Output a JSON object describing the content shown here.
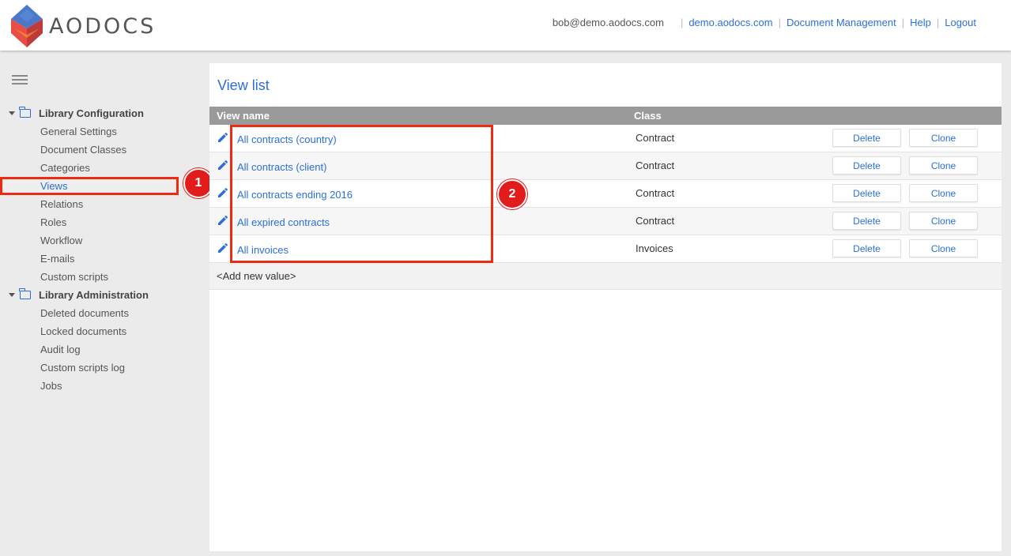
{
  "header": {
    "logo_text": "AODOCS",
    "user_email": "bob@demo.aodocs.com",
    "nav": [
      "demo.aodocs.com",
      "Document Management",
      "Help",
      "Logout"
    ]
  },
  "sidebar": {
    "sections": [
      {
        "label": "Library Configuration",
        "items": [
          "General Settings",
          "Document Classes",
          "Categories",
          "Views",
          "Relations",
          "Roles",
          "Workflow",
          "E-mails",
          "Custom scripts"
        ]
      },
      {
        "label": "Library Administration",
        "items": [
          "Deleted documents",
          "Locked documents",
          "Audit log",
          "Custom scripts log",
          "Jobs"
        ]
      }
    ],
    "active_item": "Views"
  },
  "annotations": {
    "badge1": "1",
    "badge2": "2"
  },
  "main": {
    "title": "View list",
    "columns": [
      "View name",
      "Class"
    ],
    "rows": [
      {
        "name": "All contracts (country)",
        "class": "Contract"
      },
      {
        "name": "All contracts (client)",
        "class": "Contract"
      },
      {
        "name": "All contracts ending 2016",
        "class": "Contract"
      },
      {
        "name": "All expired contracts",
        "class": "Contract"
      },
      {
        "name": "All invoices",
        "class": "Invoices"
      }
    ],
    "delete_label": "Delete",
    "clone_label": "Clone",
    "add_new_label": "<Add new value>"
  },
  "colors": {
    "accent": "#2c6fd6",
    "highlight": "#ee2b12",
    "header_bg": "#9a9a9a"
  }
}
